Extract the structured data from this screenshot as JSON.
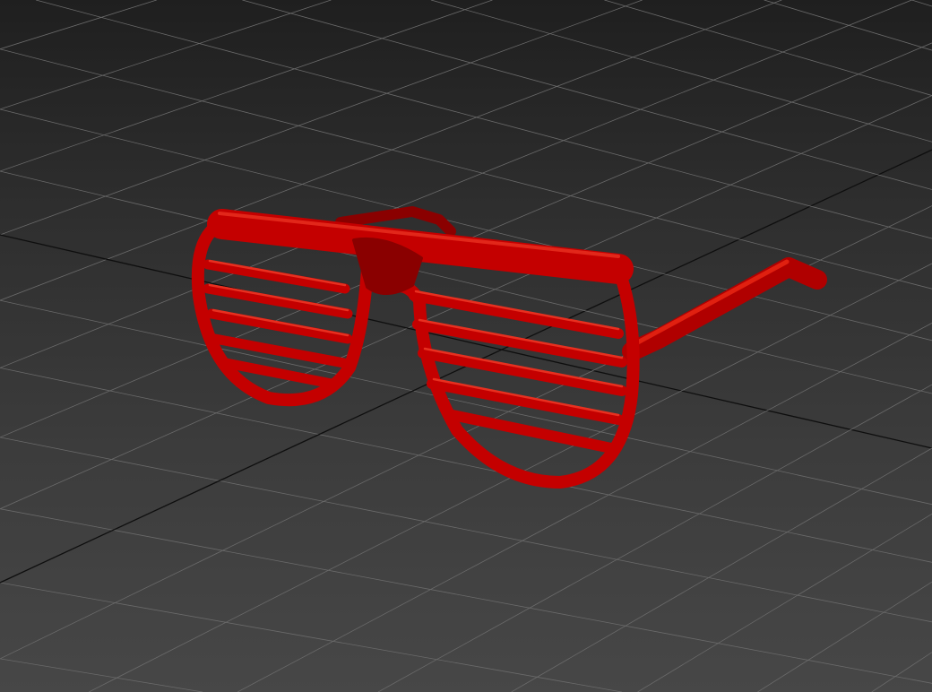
{
  "viewport": {
    "background_top": "#1f1f1f",
    "background_bottom": "#474747",
    "grid_color": "#6a6a6a",
    "axis_color": "#0e0e0e"
  },
  "model": {
    "color": "#c40000",
    "shadow_color": "#6e0000",
    "highlight_color": "#ff3a2a"
  }
}
